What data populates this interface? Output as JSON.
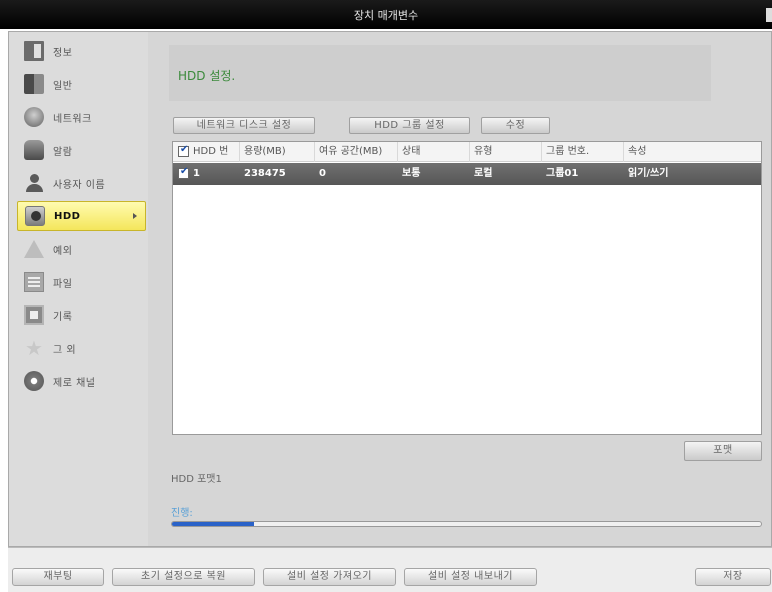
{
  "window": {
    "title": "장치 매개변수"
  },
  "sidebar": {
    "items": [
      {
        "label": "정보",
        "icon": "info-doc-icon"
      },
      {
        "label": "일반",
        "icon": "general-book-icon"
      },
      {
        "label": "네트워크",
        "icon": "network-globe-icon"
      },
      {
        "label": "알람",
        "icon": "alarm-icon"
      },
      {
        "label": "사용자 이름",
        "icon": "user-icon"
      },
      {
        "label": "HDD",
        "icon": "hdd-icon",
        "active": true
      },
      {
        "label": "예외",
        "icon": "warning-icon"
      },
      {
        "label": "파일",
        "icon": "file-icon"
      },
      {
        "label": "기록",
        "icon": "log-icon"
      },
      {
        "label": "그 외",
        "icon": "star-icon"
      },
      {
        "label": "제로 채널",
        "icon": "zero-channel-icon"
      }
    ]
  },
  "header": {
    "text": "HDD 설정."
  },
  "toolbar": {
    "network_disk_label": "네트워크 디스크 설정",
    "hdd_group_label": "HDD 그룹 설정",
    "edit_label": "수정"
  },
  "table": {
    "columns": [
      "HDD 번호.",
      "용량(MB)",
      "여유 공간(MB)",
      "상태",
      "유형",
      "그룹 번호.",
      "속성"
    ],
    "rows": [
      {
        "no": "1",
        "capacity": "238475",
        "free": "0",
        "status": "보통",
        "type": "로컬",
        "group": "그룹01",
        "property": "읽기/쓰기"
      }
    ]
  },
  "format": {
    "button_label": "포맷",
    "label": "HDD 포맷1"
  },
  "progress": {
    "label": "진행:",
    "value": 0.14
  },
  "footer": {
    "reboot_label": "재부팅",
    "restore_label": "초기 설정으로 복원",
    "import_label": "설비 설정 가져오기",
    "export_label": "설비 설정 내보내기",
    "save_label": "저장"
  },
  "colors": {
    "accent": "#f4e65b",
    "header_text": "#3b8a3b",
    "progress": "#2a62c8",
    "progress_label": "#5aa0d6"
  }
}
